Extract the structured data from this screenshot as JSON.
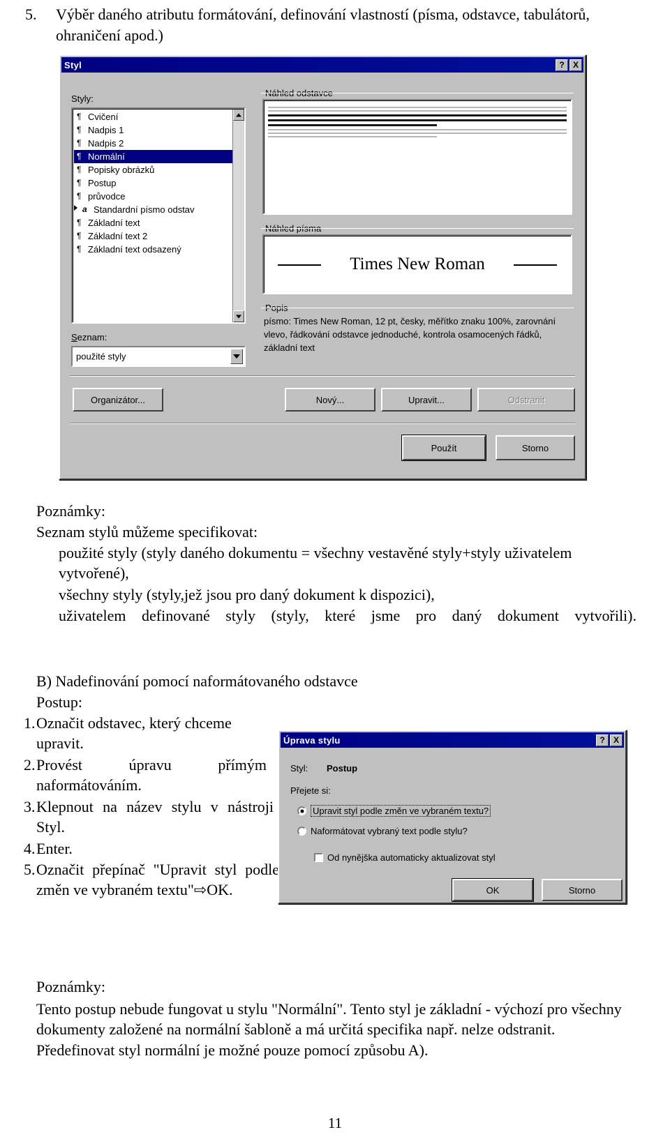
{
  "heading": {
    "number": "5.",
    "text": "Výběr daného atributu formátování, definování vlastností (písma, odstavce, tabulátorů, ohraničení apod.)"
  },
  "styl_dialog": {
    "title": "Styl",
    "help_button": "?",
    "close_button": "X",
    "styly_label": "Styly:",
    "styles": [
      {
        "mark": "¶",
        "label": "Cvičení",
        "selected": false,
        "expandable": false
      },
      {
        "mark": "¶",
        "label": "Nadpis 1",
        "selected": false,
        "expandable": false
      },
      {
        "mark": "¶",
        "label": "Nadpis 2",
        "selected": false,
        "expandable": false
      },
      {
        "mark": "¶",
        "label": "Normální",
        "selected": true,
        "expandable": false
      },
      {
        "mark": "¶",
        "label": "Popisky obrázků",
        "selected": false,
        "expandable": false
      },
      {
        "mark": "¶",
        "label": "Postup",
        "selected": false,
        "expandable": false
      },
      {
        "mark": "¶",
        "label": "průvodce",
        "selected": false,
        "expandable": false
      },
      {
        "mark": "a",
        "label": "Standardní písmo odstav",
        "selected": false,
        "expandable": true
      },
      {
        "mark": "¶",
        "label": "Základní text",
        "selected": false,
        "expandable": false
      },
      {
        "mark": "¶",
        "label": "Základní text 2",
        "selected": false,
        "expandable": false
      },
      {
        "mark": "¶",
        "label": "Základní text odsazený",
        "selected": false,
        "expandable": false
      }
    ],
    "seznam_label": "Seznam:",
    "seznam_value": "použité styly",
    "preview_paragraph_label": "Náhled odstavce",
    "preview_font_label": "Náhled písma",
    "font_sample": "Times New Roman",
    "popis_label": "Popis",
    "popis_text": "písmo: Times New Roman, 12 pt, česky, měřítko znaku 100%, zarovnání vlevo, řádkování odstavce jednoduché, kontrola osamocených řádků, základní text",
    "buttons": {
      "organizator": "Organizátor...",
      "novy": "Nový...",
      "upravit": "Upravit...",
      "odstranit": "Odstranit",
      "pouzit": "Použít",
      "storno": "Storno"
    }
  },
  "notes_1": {
    "title": "Poznámky:",
    "intro": "Seznam stylů můžeme specifikovat:",
    "items": [
      "použité styly (styly daného dokumentu = všechny vestavěné styly+styly uživatelem vytvořené),",
      "všechny styly (styly,jež jsou pro daný dokument k dispozici),",
      "uživatelem definované styly (styly, které jsme pro daný dokument vytvořili)."
    ]
  },
  "section_b": {
    "heading": "B) Nadefinování pomocí naformátovaného odstavce",
    "postup_label": "Postup:",
    "steps": [
      {
        "num": "1.",
        "text": "Označit odstavec, který chceme upravit."
      },
      {
        "num": "2.",
        "text": "Provést úpravu přímým naformátováním."
      },
      {
        "num": "3.",
        "text": "Klepnout na název stylu v nástroji Styl."
      },
      {
        "num": "4.",
        "text": "Enter."
      },
      {
        "num": "5.",
        "text": "Označit přepínač \"Upravit styl podle změn ve vybraném textu\"⇨OK."
      }
    ]
  },
  "uprava_dialog": {
    "title": "Úprava stylu",
    "help_button": "?",
    "close_button": "X",
    "styl_label": "Styl:",
    "styl_value": "Postup",
    "prejete_label": "Přejete si:",
    "radio_1": "Upravit styl podle změn ve vybraném textu?",
    "radio_2": "Naformátovat vybraný text podle stylu?",
    "checkbox": "Od nynějška automaticky aktualizovat styl",
    "ok_button": "OK",
    "storno_button": "Storno"
  },
  "notes_2": {
    "title": "Poznámky:",
    "text": "Tento postup nebude fungovat u stylu \"Normální\". Tento styl je základní - výchozí pro všechny dokumenty založené na normální šabloně a má určitá specifika např. nelze odstranit. Předefinovat styl normální je možné pouze pomocí způsobu A)."
  },
  "page_number": "11"
}
